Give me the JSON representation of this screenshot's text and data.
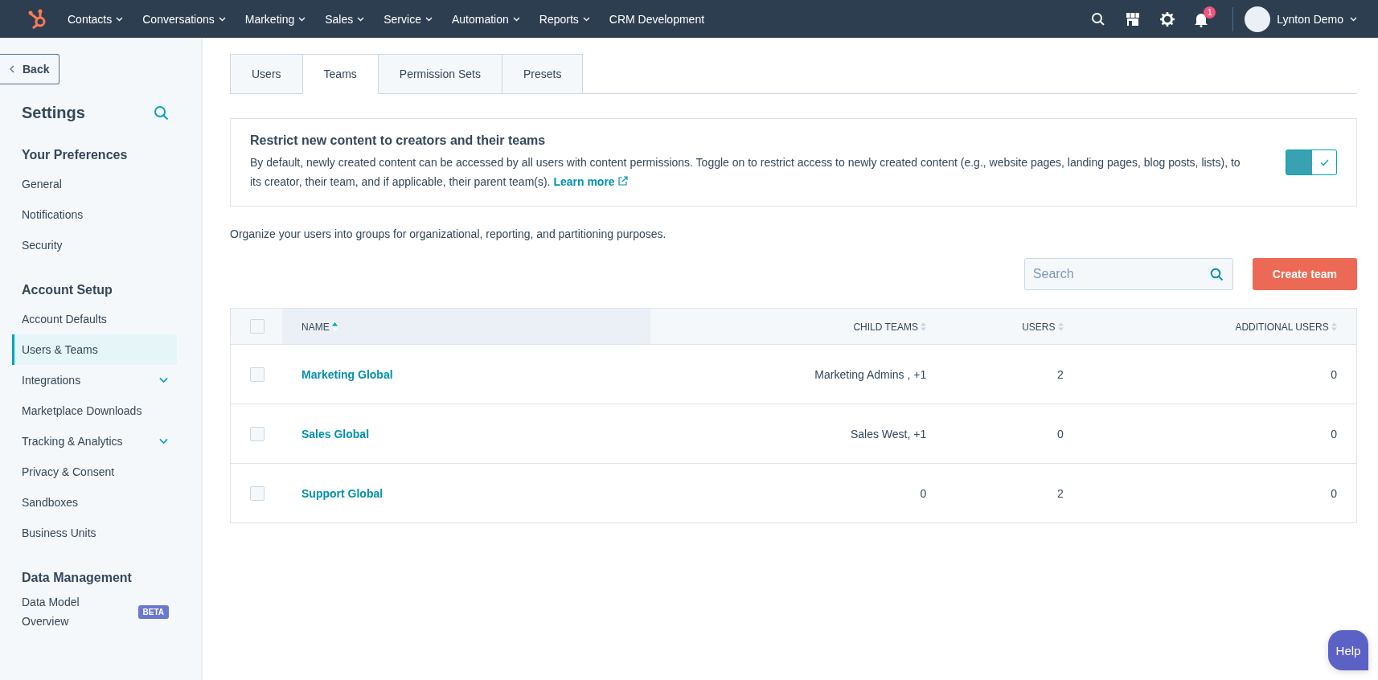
{
  "top_nav": {
    "menus": [
      {
        "label": "Contacts",
        "dropdown": true
      },
      {
        "label": "Conversations",
        "dropdown": true
      },
      {
        "label": "Marketing",
        "dropdown": true
      },
      {
        "label": "Sales",
        "dropdown": true
      },
      {
        "label": "Service",
        "dropdown": true
      },
      {
        "label": "Automation",
        "dropdown": true
      },
      {
        "label": "Reports",
        "dropdown": true
      },
      {
        "label": "CRM Development",
        "dropdown": false
      }
    ],
    "notification_count": "1",
    "user": "Lynton Demo"
  },
  "sidebar": {
    "back": "Back",
    "title": "Settings",
    "sections": [
      {
        "heading": "Your Preferences",
        "items": [
          {
            "label": "General",
            "selected": false,
            "expandable": false
          },
          {
            "label": "Notifications",
            "selected": false,
            "expandable": false
          },
          {
            "label": "Security",
            "selected": false,
            "expandable": false
          }
        ]
      },
      {
        "heading": "Account Setup",
        "items": [
          {
            "label": "Account Defaults",
            "selected": false,
            "expandable": false
          },
          {
            "label": "Users & Teams",
            "selected": true,
            "expandable": false
          },
          {
            "label": "Integrations",
            "selected": false,
            "expandable": true
          },
          {
            "label": "Marketplace Downloads",
            "selected": false,
            "expandable": false
          },
          {
            "label": "Tracking & Analytics",
            "selected": false,
            "expandable": true
          },
          {
            "label": "Privacy & Consent",
            "selected": false,
            "expandable": false
          },
          {
            "label": "Sandboxes",
            "selected": false,
            "expandable": false
          },
          {
            "label": "Business Units",
            "selected": false,
            "expandable": false
          }
        ]
      },
      {
        "heading": "Data Management",
        "items": [
          {
            "label": "Data Model Overview",
            "selected": false,
            "expandable": false,
            "badge": "BETA"
          }
        ]
      }
    ]
  },
  "tabs": [
    {
      "label": "Users",
      "selected": false
    },
    {
      "label": "Teams",
      "selected": true
    },
    {
      "label": "Permission Sets",
      "selected": false
    },
    {
      "label": "Presets",
      "selected": false
    }
  ],
  "restrict_panel": {
    "title": "Restrict new content to creators and their teams",
    "text": "By default, newly created content can be accessed by all users with content permissions. Toggle on to restrict access to newly created content (e.g., website pages, landing pages, blog posts, lists), to its creator, their team, and if applicable, their parent team(s).",
    "link": "Learn more",
    "on": true
  },
  "intro": "Organize your users into groups for organizational, reporting, and partitioning purposes.",
  "search": {
    "placeholder": "Search"
  },
  "create_button": "Create team",
  "table": {
    "all_checked": false,
    "columns": [
      {
        "label": "NAME",
        "sorted": true
      },
      {
        "label": "CHILD TEAMS",
        "sorted": false
      },
      {
        "label": "USERS",
        "sorted": false
      },
      {
        "label": "ADDITIONAL USERS",
        "sorted": false
      }
    ],
    "rows": [
      {
        "name": "Marketing Global",
        "child_teams": "Marketing Admins , +1",
        "users": "2",
        "additional_users": "0",
        "checked": false
      },
      {
        "name": "Sales Global",
        "child_teams": "Sales West, +1",
        "users": "0",
        "additional_users": "0",
        "checked": false
      },
      {
        "name": "Support Global",
        "child_teams": "0",
        "users": "2",
        "additional_users": "0",
        "checked": false
      }
    ]
  },
  "help": "Help"
}
